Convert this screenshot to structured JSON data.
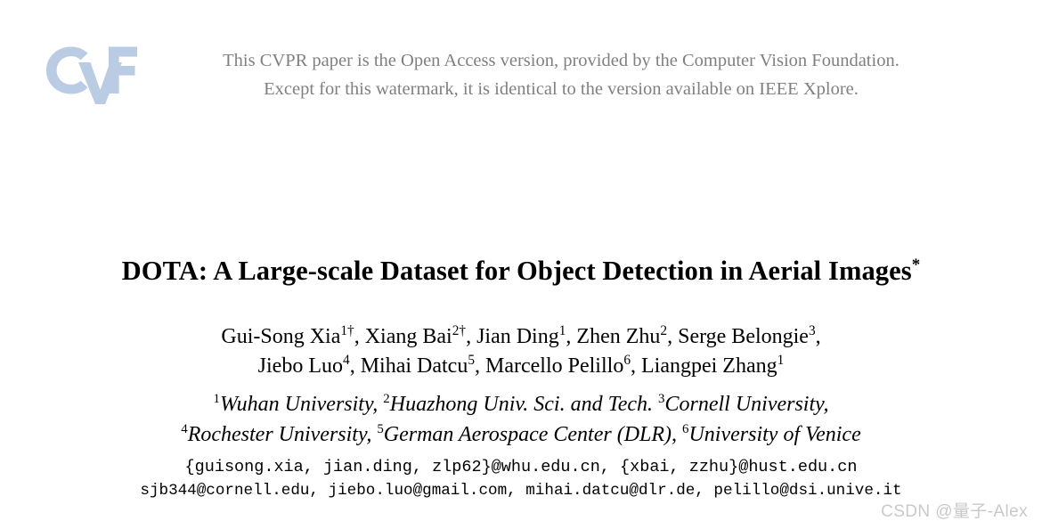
{
  "document": {
    "kind": "cvpr-open-access-paper-title-page",
    "page_background": "#ffffff"
  },
  "open_access_header": {
    "logo": {
      "icon": "cvf-logo-icon",
      "text": "CvF",
      "color": "#b9cce4"
    },
    "notice_line_1": "This CVPR paper is the Open Access version, provided by the Computer Vision Foundation.",
    "notice_line_2": "Except for this watermark, it is identical to the version available on IEEE Xplore.",
    "text_color": "#808080"
  },
  "paper": {
    "title_main": "DOTA: A Large-scale Dataset for Object Detection in Aerial Images",
    "title_footnote_marker": "*",
    "authors": {
      "line1": [
        {
          "name": "Gui-Song Xia",
          "sup": "1†",
          "sep": ", "
        },
        {
          "name": "Xiang Bai",
          "sup": "2†",
          "sep": ", "
        },
        {
          "name": "Jian Ding",
          "sup": "1",
          "sep": ", "
        },
        {
          "name": "Zhen Zhu",
          "sup": "2",
          "sep": ", "
        },
        {
          "name": "Serge Belongie",
          "sup": "3",
          "sep": ","
        }
      ],
      "line2": [
        {
          "name": "Jiebo Luo",
          "sup": "4",
          "sep": ", "
        },
        {
          "name": "Mihai Datcu",
          "sup": "5",
          "sep": ", "
        },
        {
          "name": "Marcello Pelillo",
          "sup": "6",
          "sep": ", "
        },
        {
          "name": "Liangpei Zhang",
          "sup": "1",
          "sep": ""
        }
      ]
    },
    "affiliations": {
      "line1": [
        {
          "sup": "1",
          "name": "Wuhan University",
          "sep": ", "
        },
        {
          "sup": "2",
          "name": "Huazhong Univ. Sci. and Tech.",
          "sep": " "
        },
        {
          "sup": "3",
          "name": "Cornell University",
          "sep": ","
        }
      ],
      "line2": [
        {
          "sup": "4",
          "name": "Rochester University",
          "sep": ", "
        },
        {
          "sup": "5",
          "name": "German Aerospace Center (DLR)",
          "sep": ", "
        },
        {
          "sup": "6",
          "name": "University of Venice",
          "sep": ""
        }
      ]
    },
    "emails": {
      "line1": "{guisong.xia, jian.ding, zlp62}@whu.edu.cn, {xbai, zzhu}@hust.edu.cn",
      "line2": "sjb344@cornell.edu, jiebo.luo@gmail.com, mihai.datcu@dlr.de, pelillo@dsi.unive.it"
    }
  },
  "watermark": {
    "text": "CSDN @量子-Alex",
    "color": "#c9c9c9"
  }
}
